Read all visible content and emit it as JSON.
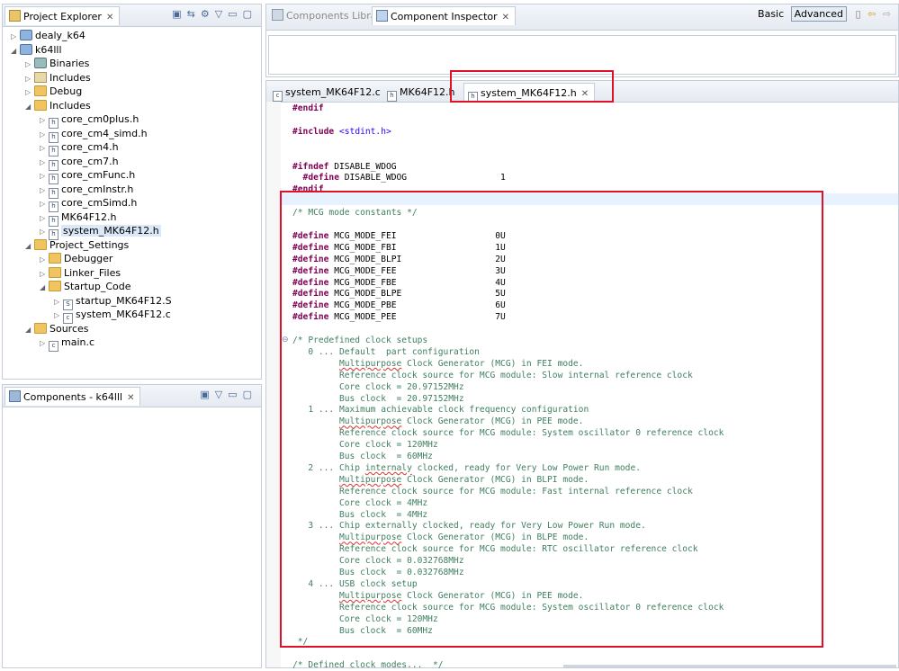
{
  "project_explorer": {
    "tab_label": "Project Explorer",
    "tree": [
      {
        "label": "dealy_k64",
        "icon": "project-icon",
        "level": 0,
        "arrow": "collapsed"
      },
      {
        "label": "k64lll",
        "icon": "project-icon",
        "level": 0,
        "arrow": "expanded"
      },
      {
        "label": "Binaries",
        "icon": "binaries-icon",
        "level": 1,
        "arrow": "collapsed"
      },
      {
        "label": "Includes",
        "icon": "includes-icon",
        "level": 1,
        "arrow": "collapsed"
      },
      {
        "label": "Debug",
        "icon": "folder-icon",
        "level": 1,
        "arrow": "collapsed"
      },
      {
        "label": "Includes",
        "icon": "folder-icon",
        "level": 1,
        "arrow": "expanded"
      },
      {
        "label": "core_cm0plus.h",
        "icon": "header-file-icon",
        "level": 2,
        "arrow": "collapsed"
      },
      {
        "label": "core_cm4_simd.h",
        "icon": "header-file-icon",
        "level": 2,
        "arrow": "collapsed"
      },
      {
        "label": "core_cm4.h",
        "icon": "header-file-icon",
        "level": 2,
        "arrow": "collapsed"
      },
      {
        "label": "core_cm7.h",
        "icon": "header-file-icon",
        "level": 2,
        "arrow": "collapsed"
      },
      {
        "label": "core_cmFunc.h",
        "icon": "header-file-icon",
        "level": 2,
        "arrow": "collapsed"
      },
      {
        "label": "core_cmInstr.h",
        "icon": "header-file-icon",
        "level": 2,
        "arrow": "collapsed"
      },
      {
        "label": "core_cmSimd.h",
        "icon": "header-file-icon",
        "level": 2,
        "arrow": "collapsed"
      },
      {
        "label": "MK64F12.h",
        "icon": "header-file-icon",
        "level": 2,
        "arrow": "collapsed"
      },
      {
        "label": "system_MK64F12.h",
        "icon": "header-file-icon",
        "level": 2,
        "arrow": "collapsed",
        "selected": true
      },
      {
        "label": "Project_Settings",
        "icon": "folder-icon",
        "level": 1,
        "arrow": "expanded"
      },
      {
        "label": "Debugger",
        "icon": "folder-icon",
        "level": 2,
        "arrow": "collapsed"
      },
      {
        "label": "Linker_Files",
        "icon": "folder-icon",
        "level": 2,
        "arrow": "collapsed"
      },
      {
        "label": "Startup_Code",
        "icon": "folder-icon",
        "level": 2,
        "arrow": "expanded"
      },
      {
        "label": "startup_MK64F12.S",
        "icon": "asm-file-icon",
        "level": 3,
        "arrow": "collapsed"
      },
      {
        "label": "system_MK64F12.c",
        "icon": "c-file-icon",
        "level": 3,
        "arrow": "collapsed"
      },
      {
        "label": "Sources",
        "icon": "folder-icon",
        "level": 1,
        "arrow": "expanded"
      },
      {
        "label": "main.c",
        "icon": "c-file-icon",
        "level": 2,
        "arrow": "collapsed"
      }
    ]
  },
  "components_view": {
    "tab_label": "Components - k64lll"
  },
  "top_tabs": {
    "components_library": "Components Library",
    "component_inspector": "Component Inspector",
    "basic": "Basic",
    "advanced": "Advanced"
  },
  "editor_tabs": [
    {
      "label": "system_MK64F12.c",
      "icon": "c-file-icon"
    },
    {
      "label": "MK64F12.h",
      "icon": "header-file-icon"
    },
    {
      "label": "system_MK64F12.h",
      "icon": "header-file-icon",
      "active": true
    }
  ],
  "code_lines": [
    [
      {
        "t": "#endif",
        "c": "kw"
      }
    ],
    [],
    [
      {
        "t": "#include",
        "c": "kw"
      },
      {
        "t": " "
      },
      {
        "t": "<stdint.h>",
        "c": "str"
      }
    ],
    [],
    [],
    [
      {
        "t": "#ifndef",
        "c": "kw"
      },
      {
        "t": " DISABLE_WDOG"
      }
    ],
    [
      {
        "t": "  #define",
        "c": "kw"
      },
      {
        "t": " DISABLE_WDOG                  1"
      }
    ],
    [
      {
        "t": "#endif",
        "c": "kw"
      }
    ],
    [],
    [
      {
        "t": "/* MCG mode constants */",
        "c": "cm"
      }
    ],
    [],
    [
      {
        "t": "#define",
        "c": "kw"
      },
      {
        "t": " MCG_MODE_FEI                   0U"
      }
    ],
    [
      {
        "t": "#define",
        "c": "kw"
      },
      {
        "t": " MCG_MODE_FBI                   1U"
      }
    ],
    [
      {
        "t": "#define",
        "c": "kw"
      },
      {
        "t": " MCG_MODE_BLPI                  2U"
      }
    ],
    [
      {
        "t": "#define",
        "c": "kw"
      },
      {
        "t": " MCG_MODE_FEE                   3U"
      }
    ],
    [
      {
        "t": "#define",
        "c": "kw"
      },
      {
        "t": " MCG_MODE_FBE                   4U"
      }
    ],
    [
      {
        "t": "#define",
        "c": "kw"
      },
      {
        "t": " MCG_MODE_BLPE                  5U"
      }
    ],
    [
      {
        "t": "#define",
        "c": "kw"
      },
      {
        "t": " MCG_MODE_PBE                   6U"
      }
    ],
    [
      {
        "t": "#define",
        "c": "kw"
      },
      {
        "t": " MCG_MODE_PEE                   7U"
      }
    ],
    [],
    [
      {
        "t": "/* Predefined clock setups",
        "c": "cm"
      }
    ],
    [
      {
        "t": "   0 ... Default  part configuration",
        "c": "cm"
      }
    ],
    [
      {
        "t": "         ",
        "c": "cm"
      },
      {
        "t": "Multipurpose",
        "c": "cm err"
      },
      {
        "t": " Clock Generator (MCG) in FEI mode.",
        "c": "cm"
      }
    ],
    [
      {
        "t": "         Reference clock source for MCG module: Slow internal reference clock",
        "c": "cm"
      }
    ],
    [
      {
        "t": "         Core clock = 20.97152MHz",
        "c": "cm"
      }
    ],
    [
      {
        "t": "         Bus clock  = 20.97152MHz",
        "c": "cm"
      }
    ],
    [
      {
        "t": "   1 ... Maximum achievable clock frequency configuration",
        "c": "cm"
      }
    ],
    [
      {
        "t": "         ",
        "c": "cm"
      },
      {
        "t": "Multipurpose",
        "c": "cm err"
      },
      {
        "t": " Clock Generator (MCG) in PEE mode.",
        "c": "cm"
      }
    ],
    [
      {
        "t": "         Reference clock source for MCG module: System oscillator 0 reference clock",
        "c": "cm"
      }
    ],
    [
      {
        "t": "         Core clock = 120MHz",
        "c": "cm"
      }
    ],
    [
      {
        "t": "         Bus clock  = 60MHz",
        "c": "cm"
      }
    ],
    [
      {
        "t": "   2 ... Chip ",
        "c": "cm"
      },
      {
        "t": "internaly",
        "c": "cm err"
      },
      {
        "t": " clocked, ready for Very Low Power Run mode.",
        "c": "cm"
      }
    ],
    [
      {
        "t": "         ",
        "c": "cm"
      },
      {
        "t": "Multipurpose",
        "c": "cm err"
      },
      {
        "t": " Clock Generator (MCG) in BLPI mode.",
        "c": "cm"
      }
    ],
    [
      {
        "t": "         Reference clock source for MCG module: Fast internal reference clock",
        "c": "cm"
      }
    ],
    [
      {
        "t": "         Core clock = 4MHz",
        "c": "cm"
      }
    ],
    [
      {
        "t": "         Bus clock  = 4MHz",
        "c": "cm"
      }
    ],
    [
      {
        "t": "   3 ... Chip externally clocked, ready for Very Low Power Run mode.",
        "c": "cm"
      }
    ],
    [
      {
        "t": "         ",
        "c": "cm"
      },
      {
        "t": "Multipurpose",
        "c": "cm err"
      },
      {
        "t": " Clock Generator (MCG) in BLPE mode.",
        "c": "cm"
      }
    ],
    [
      {
        "t": "         Reference clock source for MCG module: RTC oscillator reference clock",
        "c": "cm"
      }
    ],
    [
      {
        "t": "         Core clock = 0.032768MHz",
        "c": "cm"
      }
    ],
    [
      {
        "t": "         Bus clock  = 0.032768MHz",
        "c": "cm"
      }
    ],
    [
      {
        "t": "   4 ... USB clock setup",
        "c": "cm"
      }
    ],
    [
      {
        "t": "         ",
        "c": "cm"
      },
      {
        "t": "Multipurpose",
        "c": "cm err"
      },
      {
        "t": " Clock Generator (MCG) in PEE mode.",
        "c": "cm"
      }
    ],
    [
      {
        "t": "         Reference clock source for MCG module: System oscillator 0 reference clock",
        "c": "cm"
      }
    ],
    [
      {
        "t": "         Core clock = 120MHz",
        "c": "cm"
      }
    ],
    [
      {
        "t": "         Bus clock  = 60MHz",
        "c": "cm"
      }
    ],
    [
      {
        "t": " */",
        "c": "cm"
      }
    ],
    [],
    [
      {
        "t": "/* Defined clock modes...  */",
        "c": "cm"
      }
    ]
  ],
  "colors": {
    "keyword": "#7f0055",
    "comment": "#3f7f5f",
    "string": "#2a00ff",
    "highlight_box": "#e0102a"
  }
}
